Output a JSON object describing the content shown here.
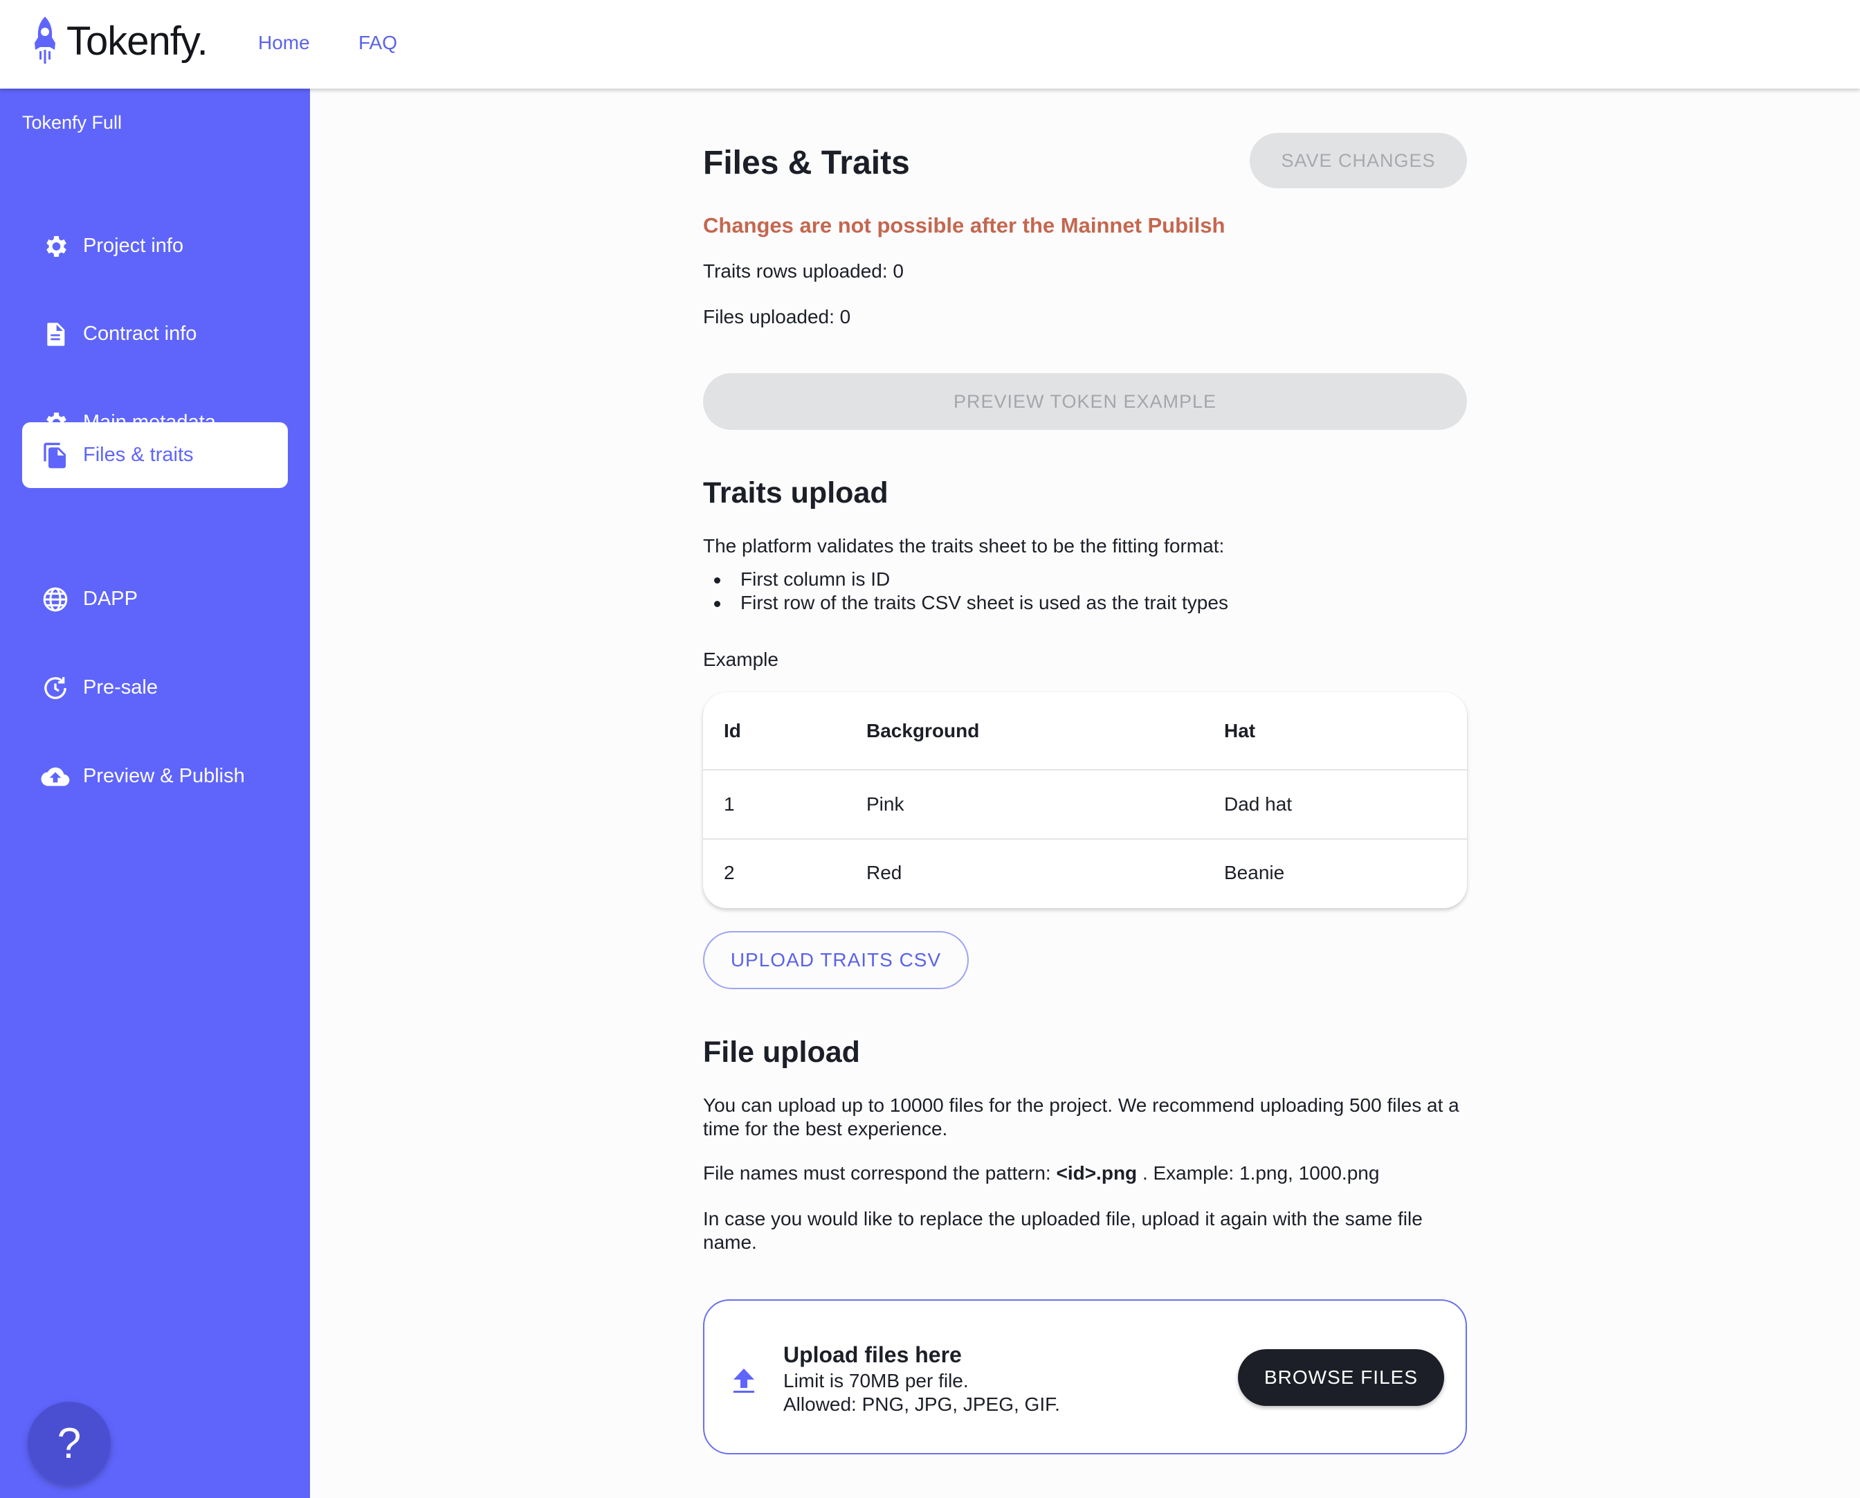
{
  "header": {
    "logo_text": "Tokenfy.",
    "nav": [
      {
        "label": "Home"
      },
      {
        "label": "FAQ"
      }
    ]
  },
  "sidebar": {
    "title": "Tokenfy Full",
    "items": [
      {
        "label": "Project info",
        "icon": "gear-icon"
      },
      {
        "label": "Contract info",
        "icon": "document-icon"
      },
      {
        "label": "Main metadata",
        "icon": "gear-icon"
      },
      {
        "label": "Files & traits",
        "icon": "files-icon",
        "active": true
      },
      {
        "label": "DAPP",
        "icon": "globe-icon"
      },
      {
        "label": "Pre-sale",
        "icon": "clock-refresh-icon"
      },
      {
        "label": "Preview & Publish",
        "icon": "cloud-upload-icon"
      }
    ],
    "help_label": "?"
  },
  "main": {
    "title": "Files & Traits",
    "save_label": "SAVE CHANGES",
    "warning": "Changes are not possible after the Mainnet Pubilsh",
    "traits_rows": "Traits rows uploaded: 0",
    "files_uploaded": "Files uploaded: 0",
    "preview_label": "PREVIEW TOKEN EXAMPLE",
    "traits_upload": {
      "heading": "Traits upload",
      "intro": "The platform validates the traits sheet to be the fitting format:",
      "bullets": [
        "First column is ID",
        "First row of the traits CSV sheet is used as the trait types"
      ],
      "example_label": "Example",
      "table": {
        "headers": [
          "Id",
          "Background",
          "Hat"
        ],
        "rows": [
          [
            "1",
            "Pink",
            "Dad hat"
          ],
          [
            "2",
            "Red",
            "Beanie"
          ]
        ]
      },
      "upload_label": "UPLOAD TRAITS CSV"
    },
    "file_upload": {
      "heading": "File upload",
      "para1": "You can upload up to 10000 files for the project. We recommend uploading 500 files at a time for the best experience.",
      "pattern_prefix": "File names must correspond the pattern:",
      "pattern_value": "<id>.png",
      "pattern_suffix": ". Example: 1.png, 1000.png",
      "para3": "In case you would like to replace the uploaded file, upload it again with the same file name.",
      "dropzone": {
        "title": "Upload files here",
        "limit": "Limit is 70MB per file.",
        "allowed": "Allowed: PNG, JPG, JPEG, GIF.",
        "browse_label": "BROWSE FILES"
      }
    }
  },
  "colors": {
    "accent": "#5f65fb",
    "warning": "#c4674f",
    "dark_button": "#1c1f27"
  }
}
